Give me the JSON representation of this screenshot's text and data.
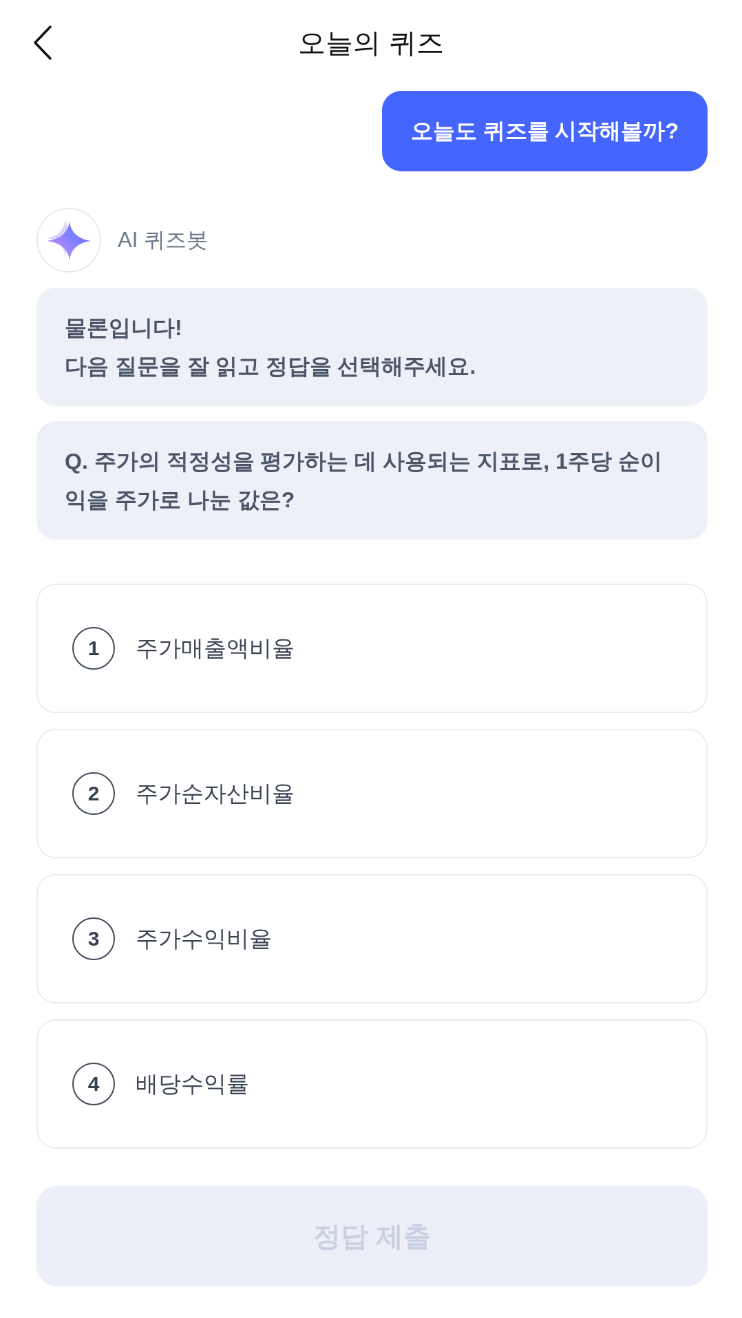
{
  "header": {
    "title": "오늘의 퀴즈"
  },
  "user_message": {
    "text": "오늘도 퀴즈를 시작해볼까?"
  },
  "bot": {
    "name": "AI 퀴즈봇",
    "messages": [
      {
        "text": "물론입니다!\n다음 질문을 잘 읽고 정답을 선택해주세요."
      },
      {
        "text": "Q. 주가의 적정성을 평가하는 데 사용되는 지표로, 1주당 순이익을 주가로 나눈 값은?"
      }
    ]
  },
  "options": [
    {
      "number": "1",
      "label": "주가매출액비율",
      "selected": false
    },
    {
      "number": "2",
      "label": "주가순자산비율",
      "selected": false
    },
    {
      "number": "3",
      "label": "주가수익비율",
      "selected": false
    },
    {
      "number": "4",
      "label": "배당수익률",
      "selected": false
    }
  ],
  "submit_button": {
    "label": "정답 제출",
    "disabled": true
  }
}
